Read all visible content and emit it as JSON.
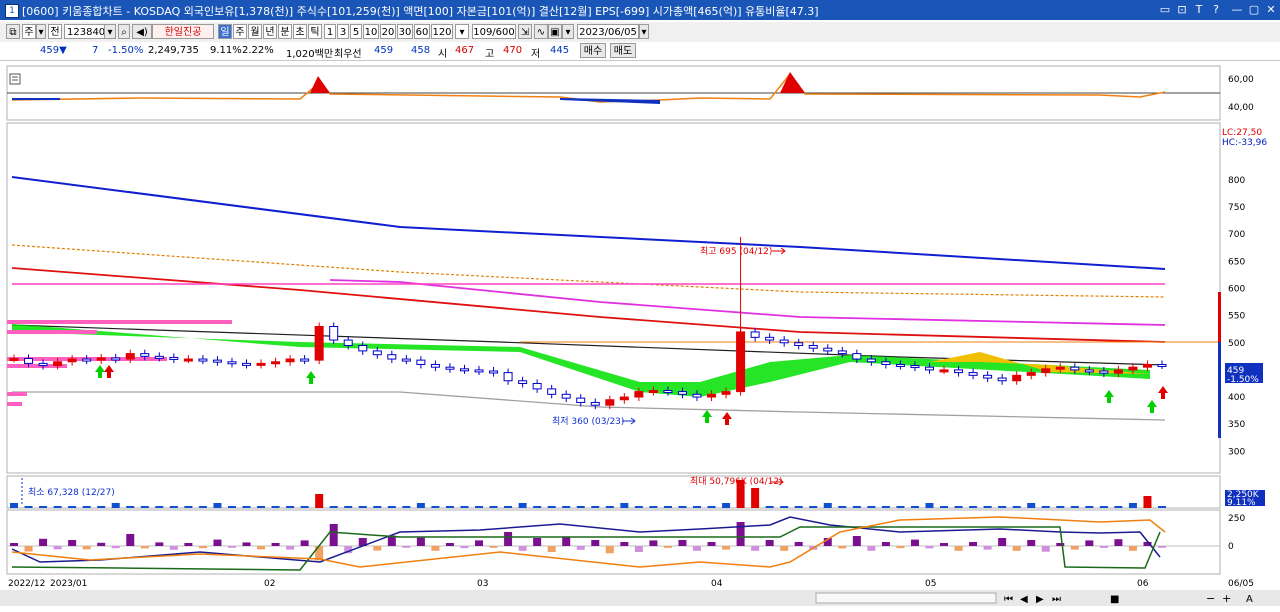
{
  "window": {
    "icon": "1",
    "title": "[0600] 키움종합차트 - KOSDAQ 외국인보유[1,378(천)] 주식수[101,259(천)] 액면[100] 자본금[101(억)] 결산[12월] EPS[-699] 시가총액[465(억)] 유통비율[47.3]",
    "controls": [
      "▭",
      "⊡",
      "T",
      "?",
      "—",
      "▢",
      "✕"
    ]
  },
  "toolbar": {
    "mode_label": "주",
    "market_label": "전",
    "code": "123840",
    "company": "한일진공",
    "period_buttons": [
      "일",
      "주",
      "월",
      "년",
      "분",
      "초",
      "틱"
    ],
    "interval_buttons": [
      "1",
      "3",
      "5",
      "10",
      "20",
      "30",
      "60",
      "120"
    ],
    "count": "109/600",
    "date": "2023/06/05"
  },
  "quote": {
    "price": "459▼",
    "change": "7",
    "change_pct": "-1.50%",
    "volume": "2,249,735",
    "turnover_pct": "9.11%",
    "vol_ratio": "2.22%",
    "amount": "1,020백만",
    "best_ask_label": "최우선",
    "ask": "459",
    "bid": "458",
    "open_label": "시",
    "open": "467",
    "high_label": "고",
    "high": "470",
    "low_label": "저",
    "low": "445",
    "buy_btn": "매수",
    "sell_btn": "매도"
  },
  "colors": {
    "up": "#e00000",
    "down": "#0000c8",
    "ma_long": "#2020c0",
    "ma_mid": "#e00000",
    "cloud": "#00e000",
    "cloud2": "#f0c000"
  },
  "chart_data": [
    {
      "type": "line",
      "title": "Indicator panel 1",
      "yticks": [
        "60,00",
        "40,00"
      ],
      "baseline": 47
    },
    {
      "type": "candlestick",
      "title": "Price",
      "lc_label": "LC:27,50",
      "hc_label": "HC:-33,96",
      "yticks": [
        "800",
        "750",
        "700",
        "650",
        "600",
        "550",
        "500",
        "450",
        "400",
        "350",
        "300"
      ],
      "ylim": [
        260,
        905
      ],
      "current_price_tag": "459",
      "current_change_tag": "-1.50%",
      "high_annotation": "최고 695 (04/12)",
      "low_annotation": "최저 360 (03/23)",
      "high": 695,
      "low": 360,
      "close_series": [
        471,
        462,
        458,
        465,
        470,
        468,
        472,
        470,
        480,
        475,
        473,
        470,
        470,
        468,
        465,
        462,
        460,
        462,
        465,
        470,
        468,
        530,
        505,
        495,
        485,
        478,
        470,
        468,
        460,
        455,
        452,
        450,
        448,
        445,
        430,
        425,
        415,
        405,
        398,
        390,
        385,
        395,
        400,
        410,
        412,
        410,
        405,
        400,
        405,
        410,
        520,
        510,
        505,
        500,
        495,
        490,
        485,
        480,
        470,
        465,
        460,
        458,
        455,
        450,
        450,
        445,
        440,
        435,
        430,
        440,
        445,
        452,
        455,
        450,
        448,
        444,
        450,
        455,
        460,
        459
      ]
    },
    {
      "type": "bar",
      "title": "Volume",
      "max_annotation": "최대 50,796K (04/12)",
      "min_annotation": "최소 67,328 (12/27)",
      "tag_value": "2,250K",
      "tag_pct": "9.11%"
    },
    {
      "type": "line",
      "title": "Oscillator",
      "yticks": [
        "250",
        "0"
      ]
    }
  ],
  "xaxis": {
    "labels": [
      "2022/12",
      "2023/01",
      "02",
      "03",
      "04",
      "05",
      "06",
      "06/05"
    ]
  },
  "statusbar": {
    "icons": [
      "⏮",
      "◀",
      "▶",
      "⏭",
      "■",
      "−",
      "+",
      "A"
    ]
  }
}
